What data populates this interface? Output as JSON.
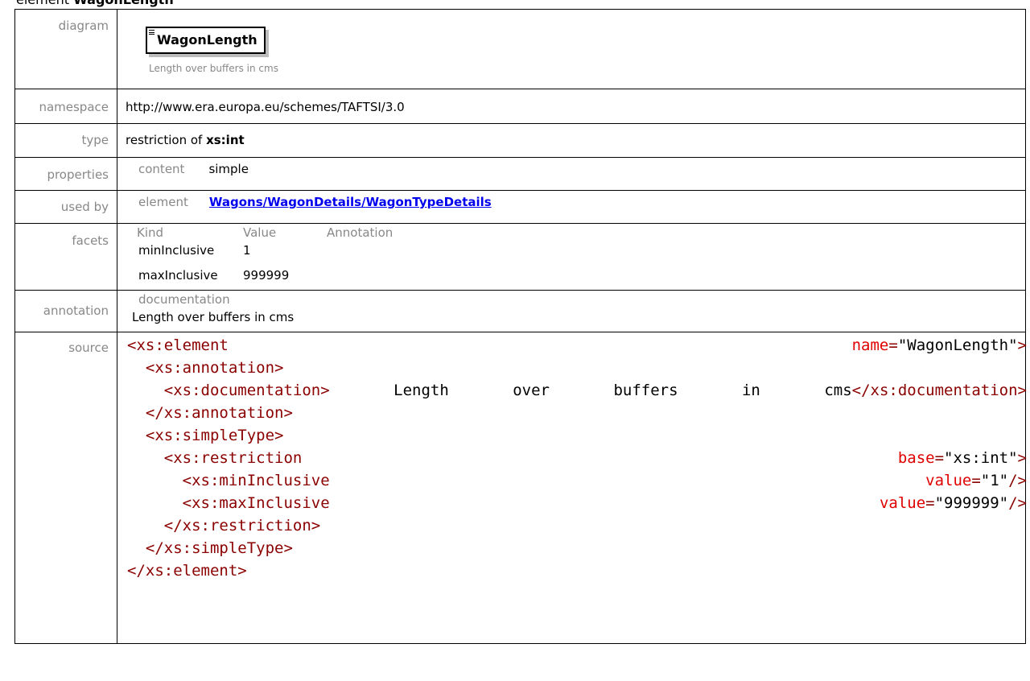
{
  "heading": {
    "prefix": "element ",
    "name": "WagonLength"
  },
  "rows": {
    "diagram": {
      "label": "diagram",
      "box_title": "WagonLength",
      "caption": "Length over buffers in cms"
    },
    "namespace": {
      "label": "namespace",
      "value": "http://www.era.europa.eu/schemes/TAFTSI/3.0"
    },
    "type": {
      "label": "type",
      "prefix": "restriction of ",
      "base": "xs:int"
    },
    "properties": {
      "label": "properties",
      "key": "content",
      "value": "simple"
    },
    "used_by": {
      "label": "used by",
      "key": "element",
      "link": "Wagons/WagonDetails/WagonTypeDetails"
    },
    "facets": {
      "label": "facets",
      "headers": [
        "Kind",
        "Value",
        "Annotation"
      ],
      "rows": [
        {
          "kind": "minInclusive",
          "value": "1",
          "annotation": ""
        },
        {
          "kind": "maxInclusive",
          "value": "999999",
          "annotation": ""
        }
      ]
    },
    "annotation": {
      "label": "annotation",
      "key": "documentation",
      "text": "Length over buffers in cms"
    },
    "source": {
      "label": "source",
      "lines": [
        {
          "indent": "",
          "left_tag": "<xs:element",
          "right_attr": "name",
          "right_val": "\"WagonLength\"",
          "right_close": ">"
        },
        {
          "indent": "  ",
          "left_tag": "<xs:annotation>",
          "right_attr": "",
          "right_val": "",
          "right_close": ""
        },
        {
          "indent": "    ",
          "left_tag": "<xs:documentation>",
          "words": [
            "Length",
            "over",
            "buffers",
            "in",
            "cms"
          ],
          "end_tag": "</xs:documentation>"
        },
        {
          "indent": "  ",
          "left_tag": "</xs:annotation>",
          "right_attr": "",
          "right_val": "",
          "right_close": ""
        },
        {
          "indent": "  ",
          "left_tag": "<xs:simpleType>",
          "right_attr": "",
          "right_val": "",
          "right_close": ""
        },
        {
          "indent": "    ",
          "left_tag": "<xs:restriction",
          "right_attr": "base",
          "right_val": "\"xs:int\"",
          "right_close": ">"
        },
        {
          "indent": "      ",
          "left_tag": "<xs:minInclusive",
          "right_attr": "value",
          "right_val": "\"1\"",
          "right_close": "/>"
        },
        {
          "indent": "      ",
          "left_tag": "<xs:maxInclusive",
          "right_attr": "value",
          "right_val": "\"999999\"",
          "right_close": "/>"
        },
        {
          "indent": "    ",
          "left_tag": "</xs:restriction>",
          "right_attr": "",
          "right_val": "",
          "right_close": ""
        },
        {
          "indent": "  ",
          "left_tag": "</xs:simpleType>",
          "right_attr": "",
          "right_val": "",
          "right_close": ""
        },
        {
          "indent": "",
          "left_tag": "</xs:element>",
          "right_attr": "",
          "right_val": "",
          "right_close": ""
        }
      ]
    }
  }
}
